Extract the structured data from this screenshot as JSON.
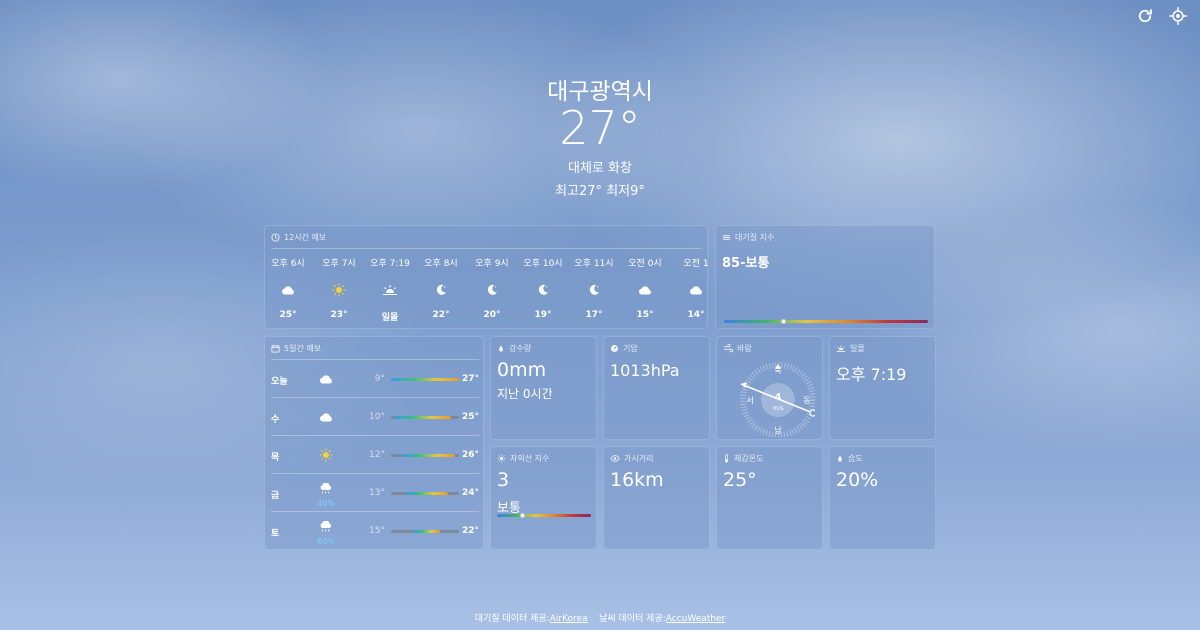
{
  "toolbar": {
    "refresh_icon": "refresh-icon",
    "locate_icon": "location-target-icon"
  },
  "current": {
    "city": "대구광역시",
    "temperature": "27°",
    "condition": "대체로 화창",
    "hi_lo": "최고27° 최저9°"
  },
  "hourly": {
    "title": "12시간 예보",
    "items": [
      {
        "time": "오후 6시",
        "icon": "cloud-icon",
        "temp": "25°"
      },
      {
        "time": "오후 7시",
        "icon": "sun-icon",
        "temp": "23°"
      },
      {
        "time": "오후 7:19",
        "icon": "sunset-icon",
        "temp": "일몰"
      },
      {
        "time": "오후 8시",
        "icon": "moon-icon",
        "temp": "22°"
      },
      {
        "time": "오후 9시",
        "icon": "moon-icon",
        "temp": "20°"
      },
      {
        "time": "오후 10시",
        "icon": "moon-icon",
        "temp": "19°"
      },
      {
        "time": "오후 11시",
        "icon": "moon-icon",
        "temp": "17°"
      },
      {
        "time": "오전 0시",
        "icon": "cloud-icon",
        "temp": "15°"
      },
      {
        "time": "오전 1",
        "icon": "cloud-icon",
        "temp": "14°"
      }
    ]
  },
  "air_quality": {
    "title": "대기질 지수",
    "value": "85-보통",
    "level_fraction": 0.29
  },
  "daily": {
    "title": "5일간 예보",
    "items": [
      {
        "day": "오늘",
        "icon": "cloud-icon",
        "pop": "",
        "low": "9°",
        "high": "27°",
        "low_value": 9,
        "high_value": 27
      },
      {
        "day": "수",
        "icon": "cloud-icon",
        "pop": "",
        "low": "10°",
        "high": "25°",
        "low_value": 10,
        "high_value": 25
      },
      {
        "day": "목",
        "icon": "sun-icon",
        "pop": "",
        "low": "12°",
        "high": "26°",
        "low_value": 12,
        "high_value": 26
      },
      {
        "day": "금",
        "icon": "rain-icon",
        "pop": "40%",
        "low": "13°",
        "high": "24°",
        "low_value": 13,
        "high_value": 24
      },
      {
        "day": "토",
        "icon": "rain-icon",
        "pop": "60%",
        "low": "15°",
        "high": "22°",
        "low_value": 15,
        "high_value": 22
      }
    ],
    "range_min": 9,
    "range_max": 27
  },
  "precipitation": {
    "title": "강수량",
    "value": "0mm",
    "sub": "지난 0시간"
  },
  "pressure": {
    "title": "기압",
    "value": "1013hPa"
  },
  "wind": {
    "title": "바람",
    "speed": "4",
    "unit": "m/s",
    "n": "북",
    "s": "남",
    "e": "동",
    "w": "서"
  },
  "sunset": {
    "title": "일몰",
    "value": "오후 7:19"
  },
  "uv": {
    "title": "자외선 지수",
    "value": "3",
    "sub": "보통",
    "level_fraction": 0.27
  },
  "visibility": {
    "title": "가시거리",
    "value": "16km"
  },
  "feels_like": {
    "title": "체감온도",
    "value": "25°"
  },
  "humidity": {
    "title": "습도",
    "value": "20%"
  },
  "footer": {
    "air_prefix": "대기질 데이터 제공:",
    "air_link": "AirKorea",
    "weather_prefix": "날씨 데이터 제공:",
    "weather_link": "AccuWeather"
  }
}
